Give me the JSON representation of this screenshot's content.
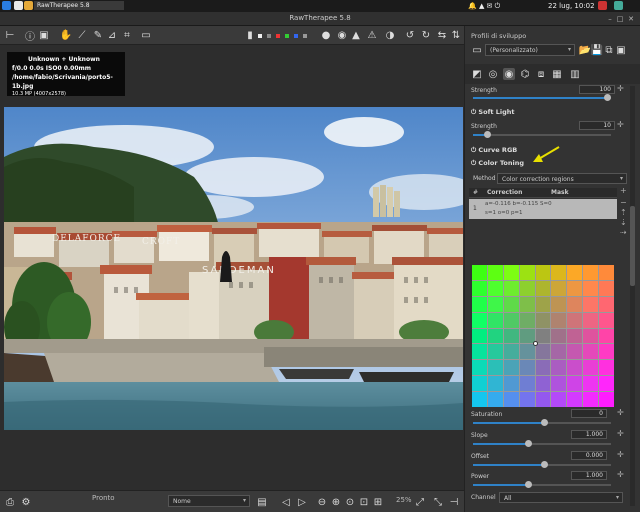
{
  "system": {
    "clock": "22 lug, 10:02"
  },
  "window": {
    "title": "RawTherapee 5.8",
    "app_label": "RawTherapee 5.8"
  },
  "info": {
    "camera": "Unknown + Unknown",
    "exposure": "f/0.0 0.0s ISO0 0.00mm",
    "path": "/home/fabio/Scrivania/porto5-1b.jpg",
    "size": "10.3 MP (4007x2578)"
  },
  "photo": {
    "signs": [
      "DELAFORCE",
      "CROFT",
      "SANDEMAN"
    ]
  },
  "bottom": {
    "status": "Pronto",
    "dropdown": "Nome",
    "zoom": "25%"
  },
  "right": {
    "profiles_title": "Profili di sviluppo",
    "profile_value": "(Personalizzato)",
    "strength_label": "Strength",
    "strength_top_value": "100",
    "soft_light": "Soft Light",
    "strength_value": "10",
    "curve_rgb": "Curve RGB",
    "color_toning": "Color Toning",
    "method_label": "Method",
    "method_value": "Color correction regions",
    "col_hash": "#",
    "col_correction": "Correction",
    "col_mask": "Mask",
    "region_row": "1",
    "region_line1": "a=-0.116 b=-0.115 S=0",
    "region_line2": "s=1 o=0 p=1",
    "saturation_label": "Saturation",
    "saturation_value": "0",
    "slope_label": "Slope",
    "slope_value": "1.000",
    "offset_label": "Offset",
    "offset_value": "0.000",
    "power_label": "Power",
    "power_value": "1.000",
    "channel_label": "Channel",
    "channel_value": "All"
  },
  "colors": {
    "accent": "#2f82c8",
    "arrow": "#e8e000"
  }
}
